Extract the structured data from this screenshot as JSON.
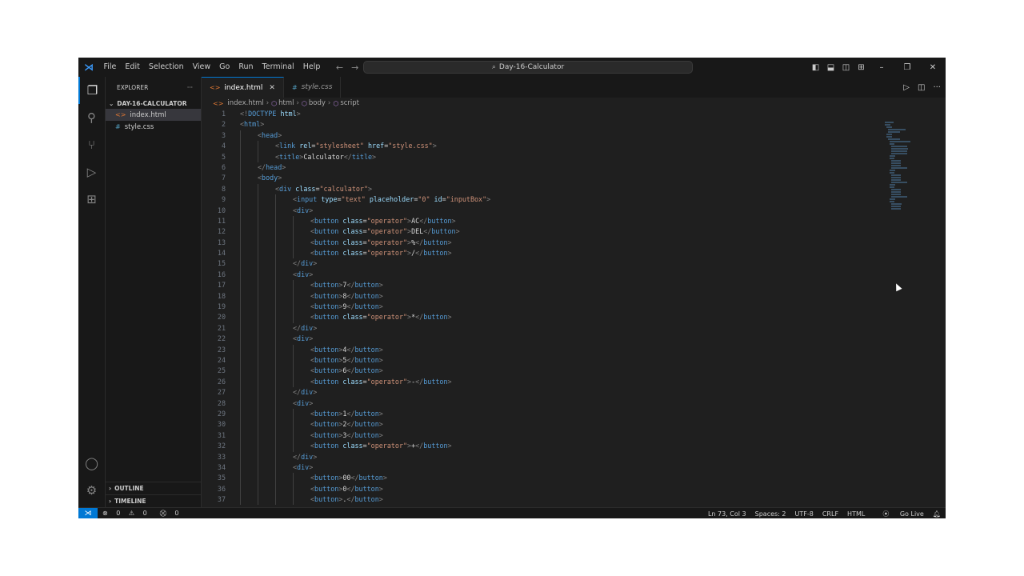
{
  "app": {
    "menu": [
      "File",
      "Edit",
      "Selection",
      "View",
      "Go",
      "Run",
      "Terminal",
      "Help"
    ],
    "search_text": "Day-16-Calculator"
  },
  "sidebar": {
    "header": "EXPLORER",
    "folder": "DAY-16-CALCULATOR",
    "files": [
      "index.html",
      "style.css"
    ],
    "outline": "OUTLINE",
    "timeline": "TIMELINE"
  },
  "tabs": [
    {
      "label": "index.html",
      "active": true
    },
    {
      "label": "style.css",
      "active": false
    }
  ],
  "breadcrumb": [
    "index.html",
    "html",
    "body",
    "script"
  ],
  "code_lines": [
    {
      "n": "1",
      "i": 0,
      "t": [
        [
          "br",
          "<!"
        ],
        [
          "doc",
          "DOCTYPE"
        ],
        [
          "txt",
          " "
        ],
        [
          "attr",
          "html"
        ],
        [
          "br",
          ">"
        ]
      ]
    },
    {
      "n": "2",
      "i": 0,
      "t": [
        [
          "br",
          "<"
        ],
        [
          "tag",
          "html"
        ],
        [
          "br",
          ">"
        ]
      ]
    },
    {
      "n": "3",
      "i": 1,
      "t": [
        [
          "br",
          "<"
        ],
        [
          "tag",
          "head"
        ],
        [
          "br",
          ">"
        ]
      ]
    },
    {
      "n": "4",
      "i": 2,
      "t": [
        [
          "br",
          "<"
        ],
        [
          "tag",
          "link"
        ],
        [
          "txt",
          " "
        ],
        [
          "attr",
          "rel"
        ],
        [
          "txt",
          "="
        ],
        [
          "str",
          "\"stylesheet\""
        ],
        [
          "txt",
          " "
        ],
        [
          "attr",
          "href"
        ],
        [
          "txt",
          "="
        ],
        [
          "str",
          "\"style.css\""
        ],
        [
          "br",
          ">"
        ]
      ]
    },
    {
      "n": "5",
      "i": 2,
      "t": [
        [
          "br",
          "<"
        ],
        [
          "tag",
          "title"
        ],
        [
          "br",
          ">"
        ],
        [
          "txt",
          "Calculator"
        ],
        [
          "br",
          "</"
        ],
        [
          "tag",
          "title"
        ],
        [
          "br",
          ">"
        ]
      ]
    },
    {
      "n": "6",
      "i": 1,
      "t": [
        [
          "br",
          "</"
        ],
        [
          "tag",
          "head"
        ],
        [
          "br",
          ">"
        ]
      ]
    },
    {
      "n": "7",
      "i": 1,
      "t": [
        [
          "br",
          "<"
        ],
        [
          "tag",
          "body"
        ],
        [
          "br",
          ">"
        ]
      ]
    },
    {
      "n": "8",
      "i": 2,
      "t": [
        [
          "br",
          "<"
        ],
        [
          "tag",
          "div"
        ],
        [
          "txt",
          " "
        ],
        [
          "attr",
          "class"
        ],
        [
          "txt",
          "="
        ],
        [
          "str",
          "\"calculator\""
        ],
        [
          "br",
          ">"
        ]
      ]
    },
    {
      "n": "9",
      "i": 3,
      "t": [
        [
          "br",
          "<"
        ],
        [
          "tag",
          "input"
        ],
        [
          "txt",
          " "
        ],
        [
          "attr",
          "type"
        ],
        [
          "txt",
          "="
        ],
        [
          "str",
          "\"text\""
        ],
        [
          "txt",
          " "
        ],
        [
          "attr",
          "placeholder"
        ],
        [
          "txt",
          "="
        ],
        [
          "str",
          "\"0\""
        ],
        [
          "txt",
          " "
        ],
        [
          "attr",
          "id"
        ],
        [
          "txt",
          "="
        ],
        [
          "str",
          "\"inputBox\""
        ],
        [
          "br",
          ">"
        ]
      ]
    },
    {
      "n": "10",
      "i": 3,
      "t": [
        [
          "br",
          "<"
        ],
        [
          "tag",
          "div"
        ],
        [
          "br",
          ">"
        ]
      ]
    },
    {
      "n": "11",
      "i": 4,
      "t": [
        [
          "br",
          "<"
        ],
        [
          "tag",
          "button"
        ],
        [
          "txt",
          " "
        ],
        [
          "attr",
          "class"
        ],
        [
          "txt",
          "="
        ],
        [
          "str",
          "\"operator\""
        ],
        [
          "br",
          ">"
        ],
        [
          "txt",
          "AC"
        ],
        [
          "br",
          "</"
        ],
        [
          "tag",
          "button"
        ],
        [
          "br",
          ">"
        ]
      ]
    },
    {
      "n": "12",
      "i": 4,
      "t": [
        [
          "br",
          "<"
        ],
        [
          "tag",
          "button"
        ],
        [
          "txt",
          " "
        ],
        [
          "attr",
          "class"
        ],
        [
          "txt",
          "="
        ],
        [
          "str",
          "\"operator\""
        ],
        [
          "br",
          ">"
        ],
        [
          "txt",
          "DEL"
        ],
        [
          "br",
          "</"
        ],
        [
          "tag",
          "button"
        ],
        [
          "br",
          ">"
        ]
      ]
    },
    {
      "n": "13",
      "i": 4,
      "t": [
        [
          "br",
          "<"
        ],
        [
          "tag",
          "button"
        ],
        [
          "txt",
          " "
        ],
        [
          "attr",
          "class"
        ],
        [
          "txt",
          "="
        ],
        [
          "str",
          "\"operator\""
        ],
        [
          "br",
          ">"
        ],
        [
          "txt",
          "%"
        ],
        [
          "br",
          "</"
        ],
        [
          "tag",
          "button"
        ],
        [
          "br",
          ">"
        ]
      ]
    },
    {
      "n": "14",
      "i": 4,
      "t": [
        [
          "br",
          "<"
        ],
        [
          "tag",
          "button"
        ],
        [
          "txt",
          " "
        ],
        [
          "attr",
          "class"
        ],
        [
          "txt",
          "="
        ],
        [
          "str",
          "\"operator\""
        ],
        [
          "br",
          ">"
        ],
        [
          "txt",
          "/"
        ],
        [
          "br",
          "</"
        ],
        [
          "tag",
          "button"
        ],
        [
          "br",
          ">"
        ]
      ]
    },
    {
      "n": "15",
      "i": 3,
      "t": [
        [
          "br",
          "</"
        ],
        [
          "tag",
          "div"
        ],
        [
          "br",
          ">"
        ]
      ]
    },
    {
      "n": "16",
      "i": 3,
      "t": [
        [
          "br",
          "<"
        ],
        [
          "tag",
          "div"
        ],
        [
          "br",
          ">"
        ]
      ]
    },
    {
      "n": "17",
      "i": 4,
      "t": [
        [
          "br",
          "<"
        ],
        [
          "tag",
          "button"
        ],
        [
          "br",
          ">"
        ],
        [
          "txt",
          "7"
        ],
        [
          "br",
          "</"
        ],
        [
          "tag",
          "button"
        ],
        [
          "br",
          ">"
        ]
      ]
    },
    {
      "n": "18",
      "i": 4,
      "t": [
        [
          "br",
          "<"
        ],
        [
          "tag",
          "button"
        ],
        [
          "br",
          ">"
        ],
        [
          "txt",
          "8"
        ],
        [
          "br",
          "</"
        ],
        [
          "tag",
          "button"
        ],
        [
          "br",
          ">"
        ]
      ]
    },
    {
      "n": "19",
      "i": 4,
      "t": [
        [
          "br",
          "<"
        ],
        [
          "tag",
          "button"
        ],
        [
          "br",
          ">"
        ],
        [
          "txt",
          "9"
        ],
        [
          "br",
          "</"
        ],
        [
          "tag",
          "button"
        ],
        [
          "br",
          ">"
        ]
      ]
    },
    {
      "n": "20",
      "i": 4,
      "t": [
        [
          "br",
          "<"
        ],
        [
          "tag",
          "button"
        ],
        [
          "txt",
          " "
        ],
        [
          "attr",
          "class"
        ],
        [
          "txt",
          "="
        ],
        [
          "str",
          "\"operator\""
        ],
        [
          "br",
          ">"
        ],
        [
          "txt",
          "*"
        ],
        [
          "br",
          "</"
        ],
        [
          "tag",
          "button"
        ],
        [
          "br",
          ">"
        ]
      ]
    },
    {
      "n": "21",
      "i": 3,
      "t": [
        [
          "br",
          "</"
        ],
        [
          "tag",
          "div"
        ],
        [
          "br",
          ">"
        ]
      ]
    },
    {
      "n": "22",
      "i": 3,
      "t": [
        [
          "br",
          "<"
        ],
        [
          "tag",
          "div"
        ],
        [
          "br",
          ">"
        ]
      ]
    },
    {
      "n": "23",
      "i": 4,
      "t": [
        [
          "br",
          "<"
        ],
        [
          "tag",
          "button"
        ],
        [
          "br",
          ">"
        ],
        [
          "txt",
          "4"
        ],
        [
          "br",
          "</"
        ],
        [
          "tag",
          "button"
        ],
        [
          "br",
          ">"
        ]
      ]
    },
    {
      "n": "24",
      "i": 4,
      "t": [
        [
          "br",
          "<"
        ],
        [
          "tag",
          "button"
        ],
        [
          "br",
          ">"
        ],
        [
          "txt",
          "5"
        ],
        [
          "br",
          "</"
        ],
        [
          "tag",
          "button"
        ],
        [
          "br",
          ">"
        ]
      ]
    },
    {
      "n": "25",
      "i": 4,
      "t": [
        [
          "br",
          "<"
        ],
        [
          "tag",
          "button"
        ],
        [
          "br",
          ">"
        ],
        [
          "txt",
          "6"
        ],
        [
          "br",
          "</"
        ],
        [
          "tag",
          "button"
        ],
        [
          "br",
          ">"
        ]
      ]
    },
    {
      "n": "26",
      "i": 4,
      "t": [
        [
          "br",
          "<"
        ],
        [
          "tag",
          "button"
        ],
        [
          "txt",
          " "
        ],
        [
          "attr",
          "class"
        ],
        [
          "txt",
          "="
        ],
        [
          "str",
          "\"operator\""
        ],
        [
          "br",
          ">"
        ],
        [
          "txt",
          "-"
        ],
        [
          "br",
          "</"
        ],
        [
          "tag",
          "button"
        ],
        [
          "br",
          ">"
        ]
      ]
    },
    {
      "n": "27",
      "i": 3,
      "t": [
        [
          "br",
          "</"
        ],
        [
          "tag",
          "div"
        ],
        [
          "br",
          ">"
        ]
      ]
    },
    {
      "n": "28",
      "i": 3,
      "t": [
        [
          "br",
          "<"
        ],
        [
          "tag",
          "div"
        ],
        [
          "br",
          ">"
        ]
      ]
    },
    {
      "n": "29",
      "i": 4,
      "t": [
        [
          "br",
          "<"
        ],
        [
          "tag",
          "button"
        ],
        [
          "br",
          ">"
        ],
        [
          "txt",
          "1"
        ],
        [
          "br",
          "</"
        ],
        [
          "tag",
          "button"
        ],
        [
          "br",
          ">"
        ]
      ]
    },
    {
      "n": "30",
      "i": 4,
      "t": [
        [
          "br",
          "<"
        ],
        [
          "tag",
          "button"
        ],
        [
          "br",
          ">"
        ],
        [
          "txt",
          "2"
        ],
        [
          "br",
          "</"
        ],
        [
          "tag",
          "button"
        ],
        [
          "br",
          ">"
        ]
      ]
    },
    {
      "n": "31",
      "i": 4,
      "t": [
        [
          "br",
          "<"
        ],
        [
          "tag",
          "button"
        ],
        [
          "br",
          ">"
        ],
        [
          "txt",
          "3"
        ],
        [
          "br",
          "</"
        ],
        [
          "tag",
          "button"
        ],
        [
          "br",
          ">"
        ]
      ]
    },
    {
      "n": "32",
      "i": 4,
      "t": [
        [
          "br",
          "<"
        ],
        [
          "tag",
          "button"
        ],
        [
          "txt",
          " "
        ],
        [
          "attr",
          "class"
        ],
        [
          "txt",
          "="
        ],
        [
          "str",
          "\"operator\""
        ],
        [
          "br",
          ">"
        ],
        [
          "txt",
          "+"
        ],
        [
          "br",
          "</"
        ],
        [
          "tag",
          "button"
        ],
        [
          "br",
          ">"
        ]
      ]
    },
    {
      "n": "33",
      "i": 3,
      "t": [
        [
          "br",
          "</"
        ],
        [
          "tag",
          "div"
        ],
        [
          "br",
          ">"
        ]
      ]
    },
    {
      "n": "34",
      "i": 3,
      "t": [
        [
          "br",
          "<"
        ],
        [
          "tag",
          "div"
        ],
        [
          "br",
          ">"
        ]
      ]
    },
    {
      "n": "35",
      "i": 4,
      "t": [
        [
          "br",
          "<"
        ],
        [
          "tag",
          "button"
        ],
        [
          "br",
          ">"
        ],
        [
          "txt",
          "00"
        ],
        [
          "br",
          "</"
        ],
        [
          "tag",
          "button"
        ],
        [
          "br",
          ">"
        ]
      ]
    },
    {
      "n": "36",
      "i": 4,
      "t": [
        [
          "br",
          "<"
        ],
        [
          "tag",
          "button"
        ],
        [
          "br",
          ">"
        ],
        [
          "txt",
          "0"
        ],
        [
          "br",
          "</"
        ],
        [
          "tag",
          "button"
        ],
        [
          "br",
          ">"
        ]
      ]
    },
    {
      "n": "37",
      "i": 4,
      "t": [
        [
          "br",
          "<"
        ],
        [
          "tag",
          "button"
        ],
        [
          "br",
          ">"
        ],
        [
          "txt",
          "."
        ],
        [
          "br",
          "</"
        ],
        [
          "tag",
          "button"
        ],
        [
          "br",
          ">"
        ]
      ]
    }
  ],
  "status": {
    "errors": "0",
    "warnings": "0",
    "ports": "0",
    "position": "Ln 73, Col 3",
    "spaces": "Spaces: 2",
    "encoding": "UTF-8",
    "eol": "CRLF",
    "language": "HTML",
    "golive": "Go Live"
  },
  "colors": {
    "accent": "#0078d4",
    "background": "#1f1f1f",
    "tag": "#569cd6",
    "attribute": "#9cdcfe",
    "string": "#ce9178"
  }
}
